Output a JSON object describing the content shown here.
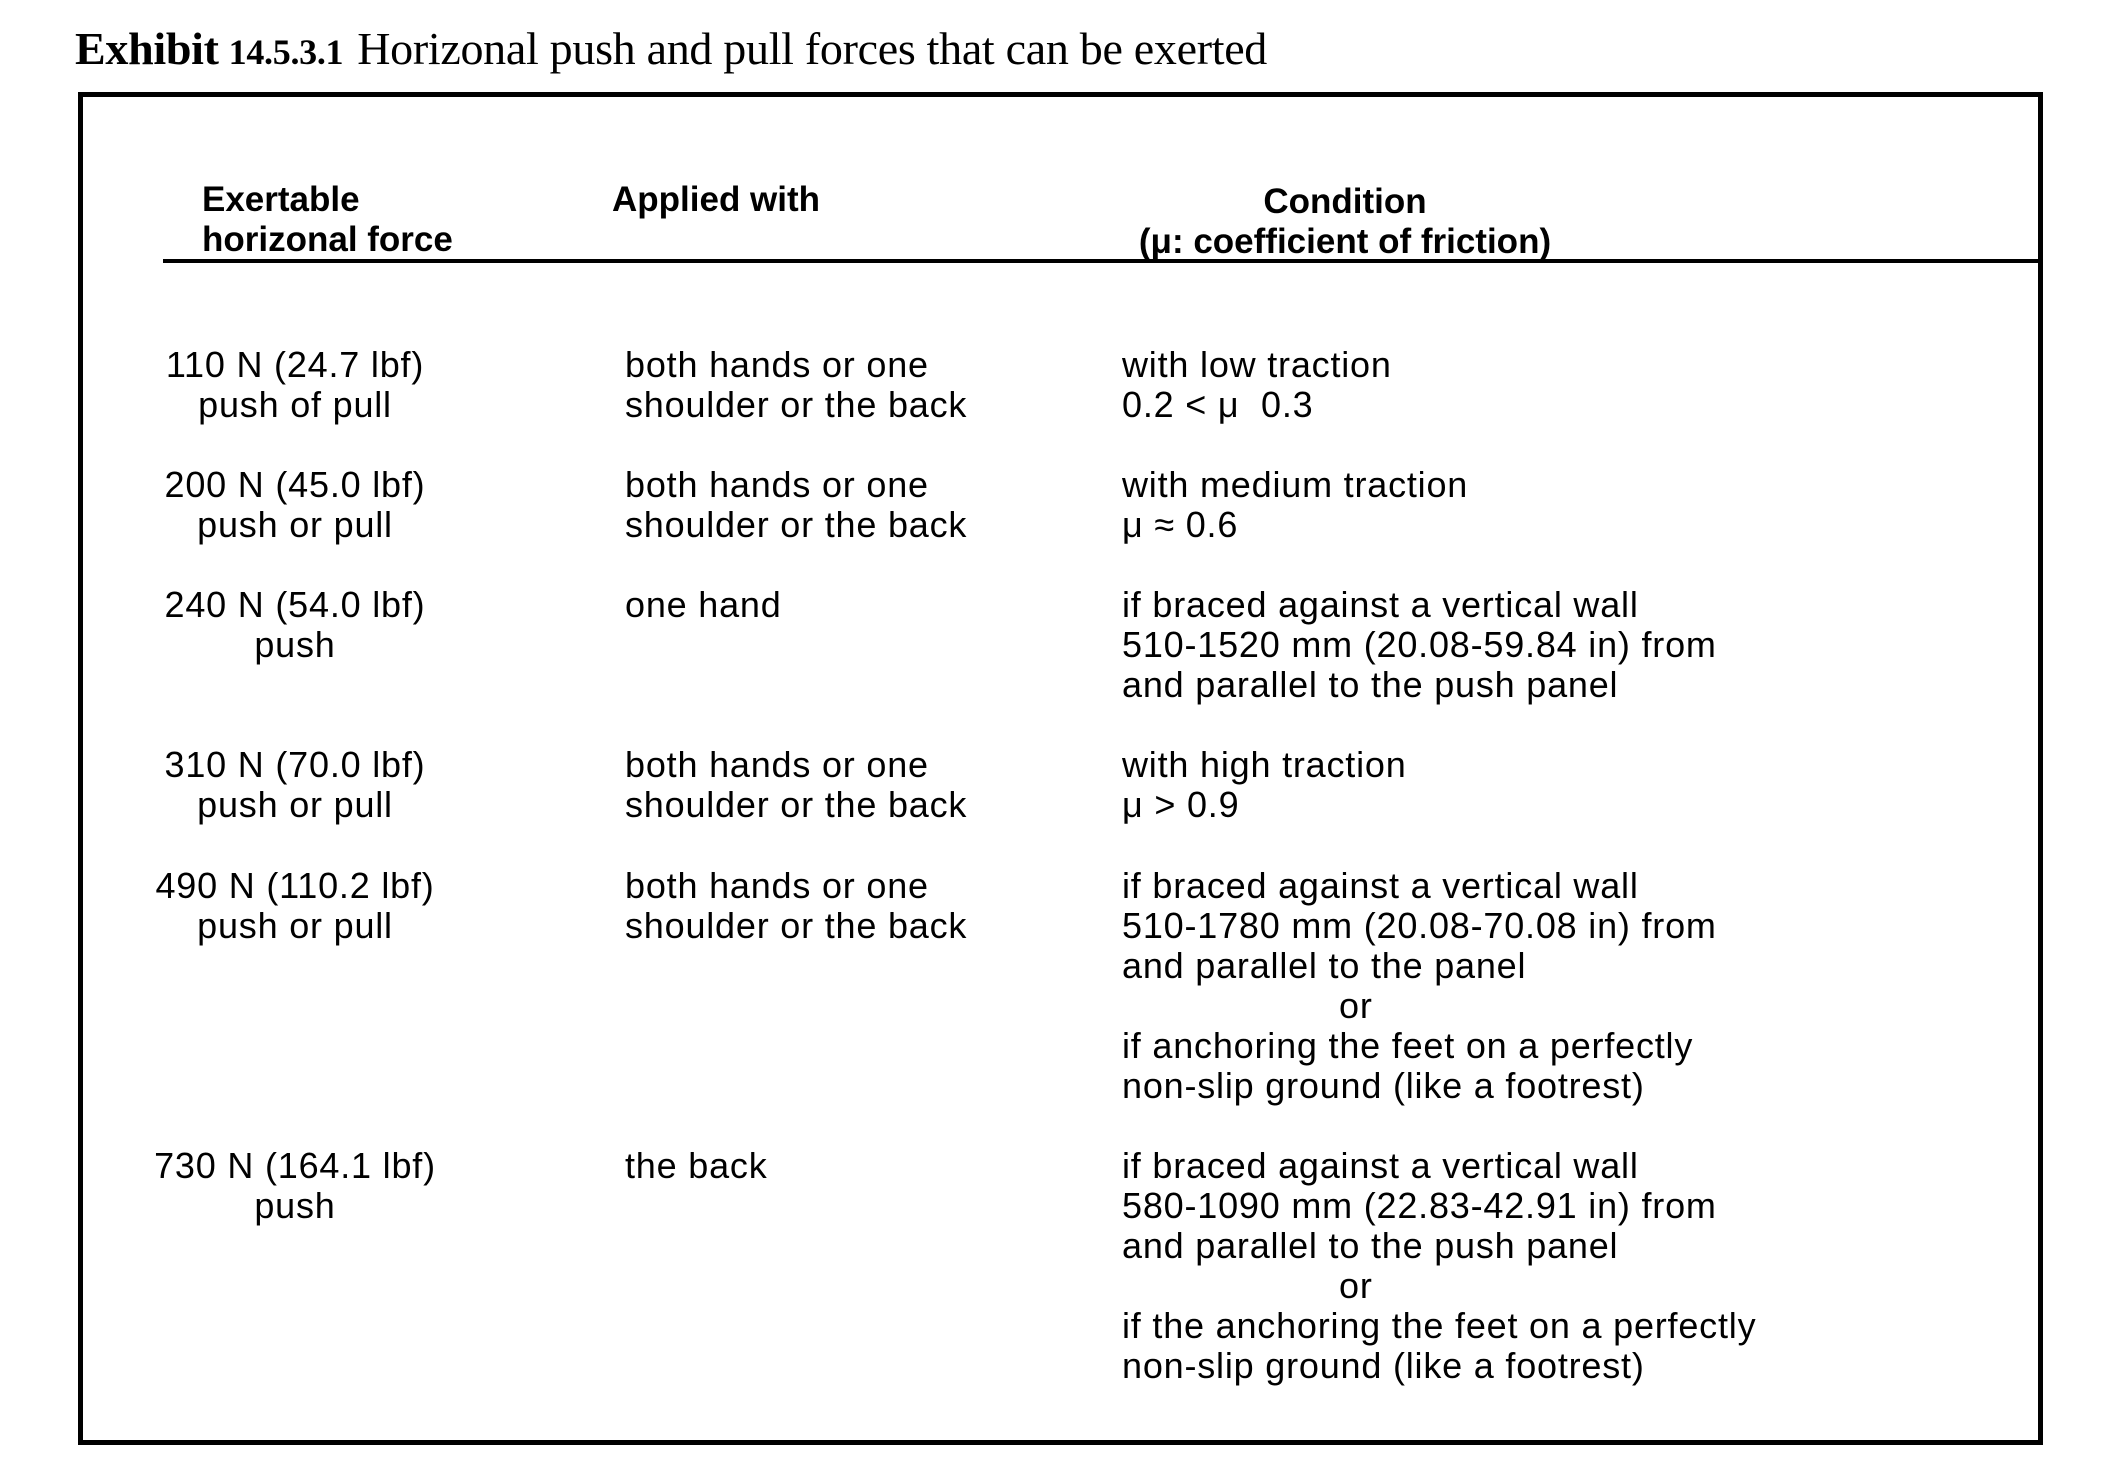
{
  "title": {
    "label": "Exhibit",
    "number": "14.5.3.1",
    "text": "Horizonal push and pull forces that can be exerted"
  },
  "table": {
    "headers": {
      "force": [
        "Exertable",
        "horizonal force"
      ],
      "applied": [
        "Applied with"
      ],
      "condition": [
        "Condition",
        "(μ: coefficient of friction)"
      ]
    },
    "rows": [
      {
        "force": [
          "110 N (24.7 lbf)",
          "push of pull"
        ],
        "applied": [
          "both hands or one",
          "shoulder or the back"
        ],
        "condition": [
          "with low traction",
          "0.2 < μ  0.3"
        ]
      },
      {
        "force": [
          "200 N (45.0 lbf)",
          "push or pull"
        ],
        "applied": [
          "both hands or one",
          "shoulder or the back"
        ],
        "condition": [
          "with medium traction",
          "μ ≈ 0.6"
        ]
      },
      {
        "force": [
          "240 N (54.0 lbf)",
          "push"
        ],
        "applied": [
          "one hand"
        ],
        "condition": [
          "if braced against a vertical wall",
          "510-1520 mm (20.08-59.84 in) from",
          "and parallel to the push panel"
        ]
      },
      {
        "force": [
          "310 N (70.0 lbf)",
          "push or pull"
        ],
        "applied": [
          "both hands or one",
          "shoulder or the back"
        ],
        "condition": [
          "with high traction",
          "μ > 0.9"
        ]
      },
      {
        "force": [
          "490 N (110.2 lbf)",
          "push or pull"
        ],
        "applied": [
          "both hands or one",
          "shoulder or the back"
        ],
        "condition": [
          "if braced against a vertical wall",
          "510-1780 mm (20.08-70.08 in) from",
          "and parallel to the panel",
          "or",
          "if anchoring the feet on a perfectly",
          "non-slip ground (like a footrest)"
        ]
      },
      {
        "force": [
          "730 N (164.1 lbf)",
          "push"
        ],
        "applied": [
          "the back"
        ],
        "condition": [
          "if braced against a vertical wall",
          "580-1090 mm (22.83-42.91 in) from",
          "and parallel to the push panel",
          "or",
          "if the anchoring the feet on a perfectly",
          "non-slip ground (like a footrest)"
        ]
      }
    ]
  }
}
